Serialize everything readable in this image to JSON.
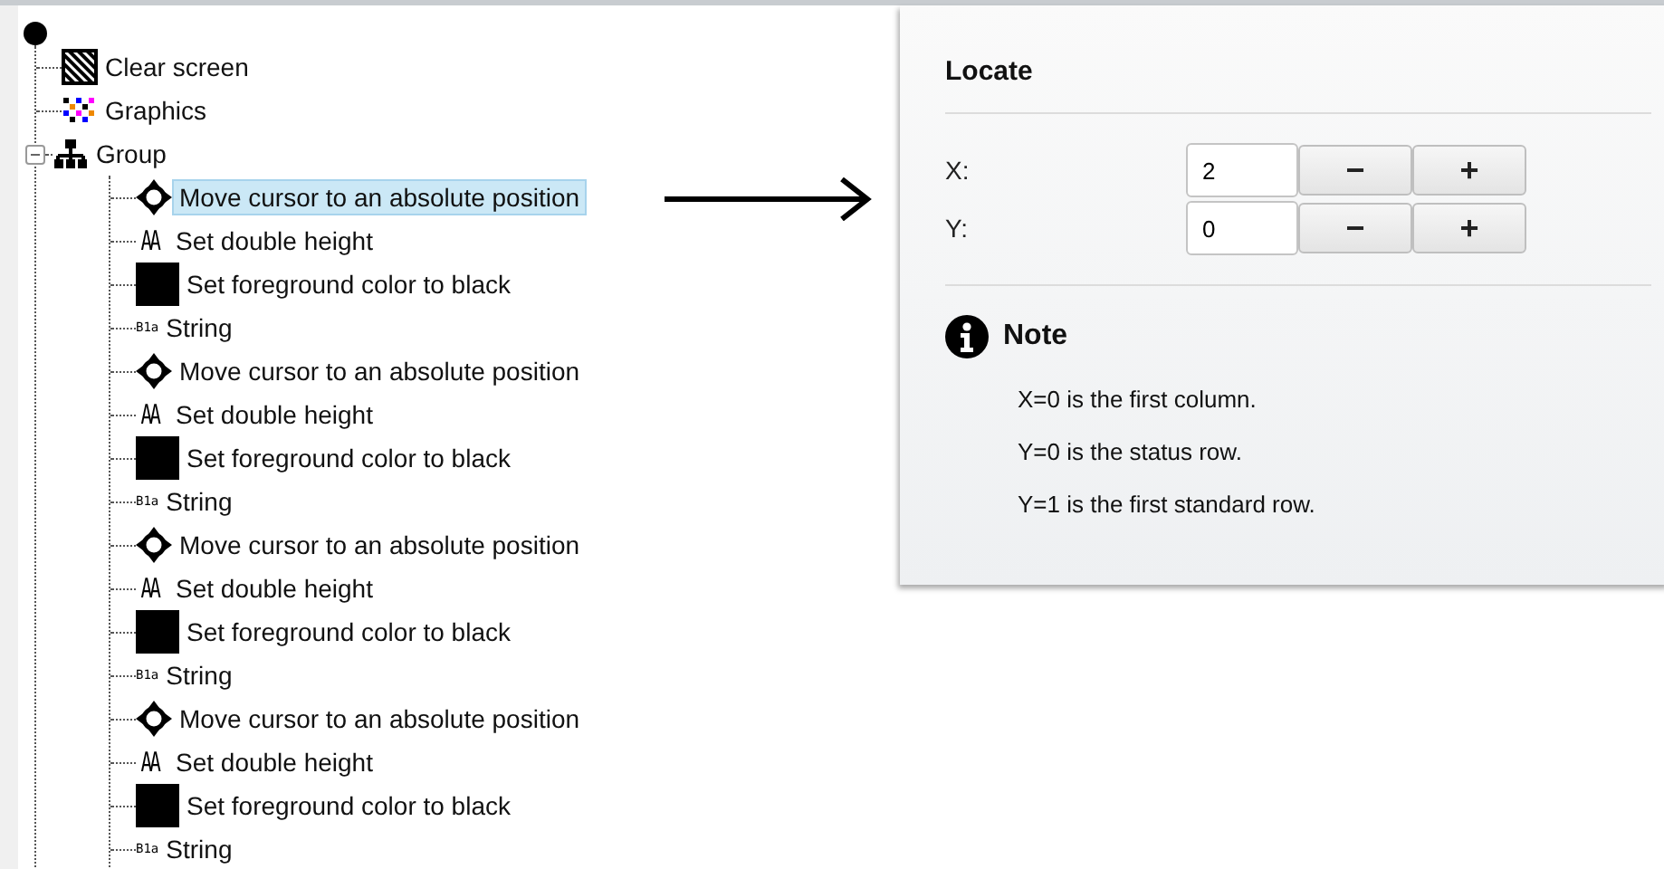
{
  "tree": {
    "items": [
      {
        "kind": "clear",
        "label": "Clear screen",
        "selected": false
      },
      {
        "kind": "graphics",
        "label": "Graphics",
        "selected": false
      },
      {
        "kind": "group",
        "label": "Group",
        "selected": false,
        "expanded": true,
        "children": [
          {
            "kind": "cursor",
            "label": "Move cursor to an absolute position",
            "selected": true
          },
          {
            "kind": "height",
            "label": "Set double height",
            "icon_text": "AA",
            "selected": false
          },
          {
            "kind": "color",
            "label": "Set foreground color to black",
            "selected": false
          },
          {
            "kind": "string",
            "label": "String",
            "icon_text": "B1a",
            "selected": false
          },
          {
            "kind": "cursor",
            "label": "Move cursor to an absolute position",
            "selected": false
          },
          {
            "kind": "height",
            "label": "Set double height",
            "icon_text": "AA",
            "selected": false
          },
          {
            "kind": "color",
            "label": "Set foreground color to black",
            "selected": false
          },
          {
            "kind": "string",
            "label": "String",
            "icon_text": "B1a",
            "selected": false
          },
          {
            "kind": "cursor",
            "label": "Move cursor to an absolute position",
            "selected": false
          },
          {
            "kind": "height",
            "label": "Set double height",
            "icon_text": "AA",
            "selected": false
          },
          {
            "kind": "color",
            "label": "Set foreground color to black",
            "selected": false
          },
          {
            "kind": "string",
            "label": "String",
            "icon_text": "B1a",
            "selected": false
          },
          {
            "kind": "cursor",
            "label": "Move cursor to an absolute position",
            "selected": false
          },
          {
            "kind": "height",
            "label": "Set double height",
            "icon_text": "AA",
            "selected": false
          },
          {
            "kind": "color",
            "label": "Set foreground color to black",
            "selected": false
          },
          {
            "kind": "string",
            "label": "String",
            "icon_text": "B1a",
            "selected": false
          }
        ]
      }
    ]
  },
  "panel": {
    "title": "Locate",
    "fields": [
      {
        "label": "X:",
        "value": "2",
        "decrement": "−",
        "increment": "+"
      },
      {
        "label": "Y:",
        "value": "0",
        "decrement": "−",
        "increment": "+"
      }
    ],
    "note": {
      "title": "Note",
      "lines": [
        "X=0 is the first column.",
        "Y=0 is the status row.",
        "Y=1 is the first standard row."
      ]
    }
  }
}
